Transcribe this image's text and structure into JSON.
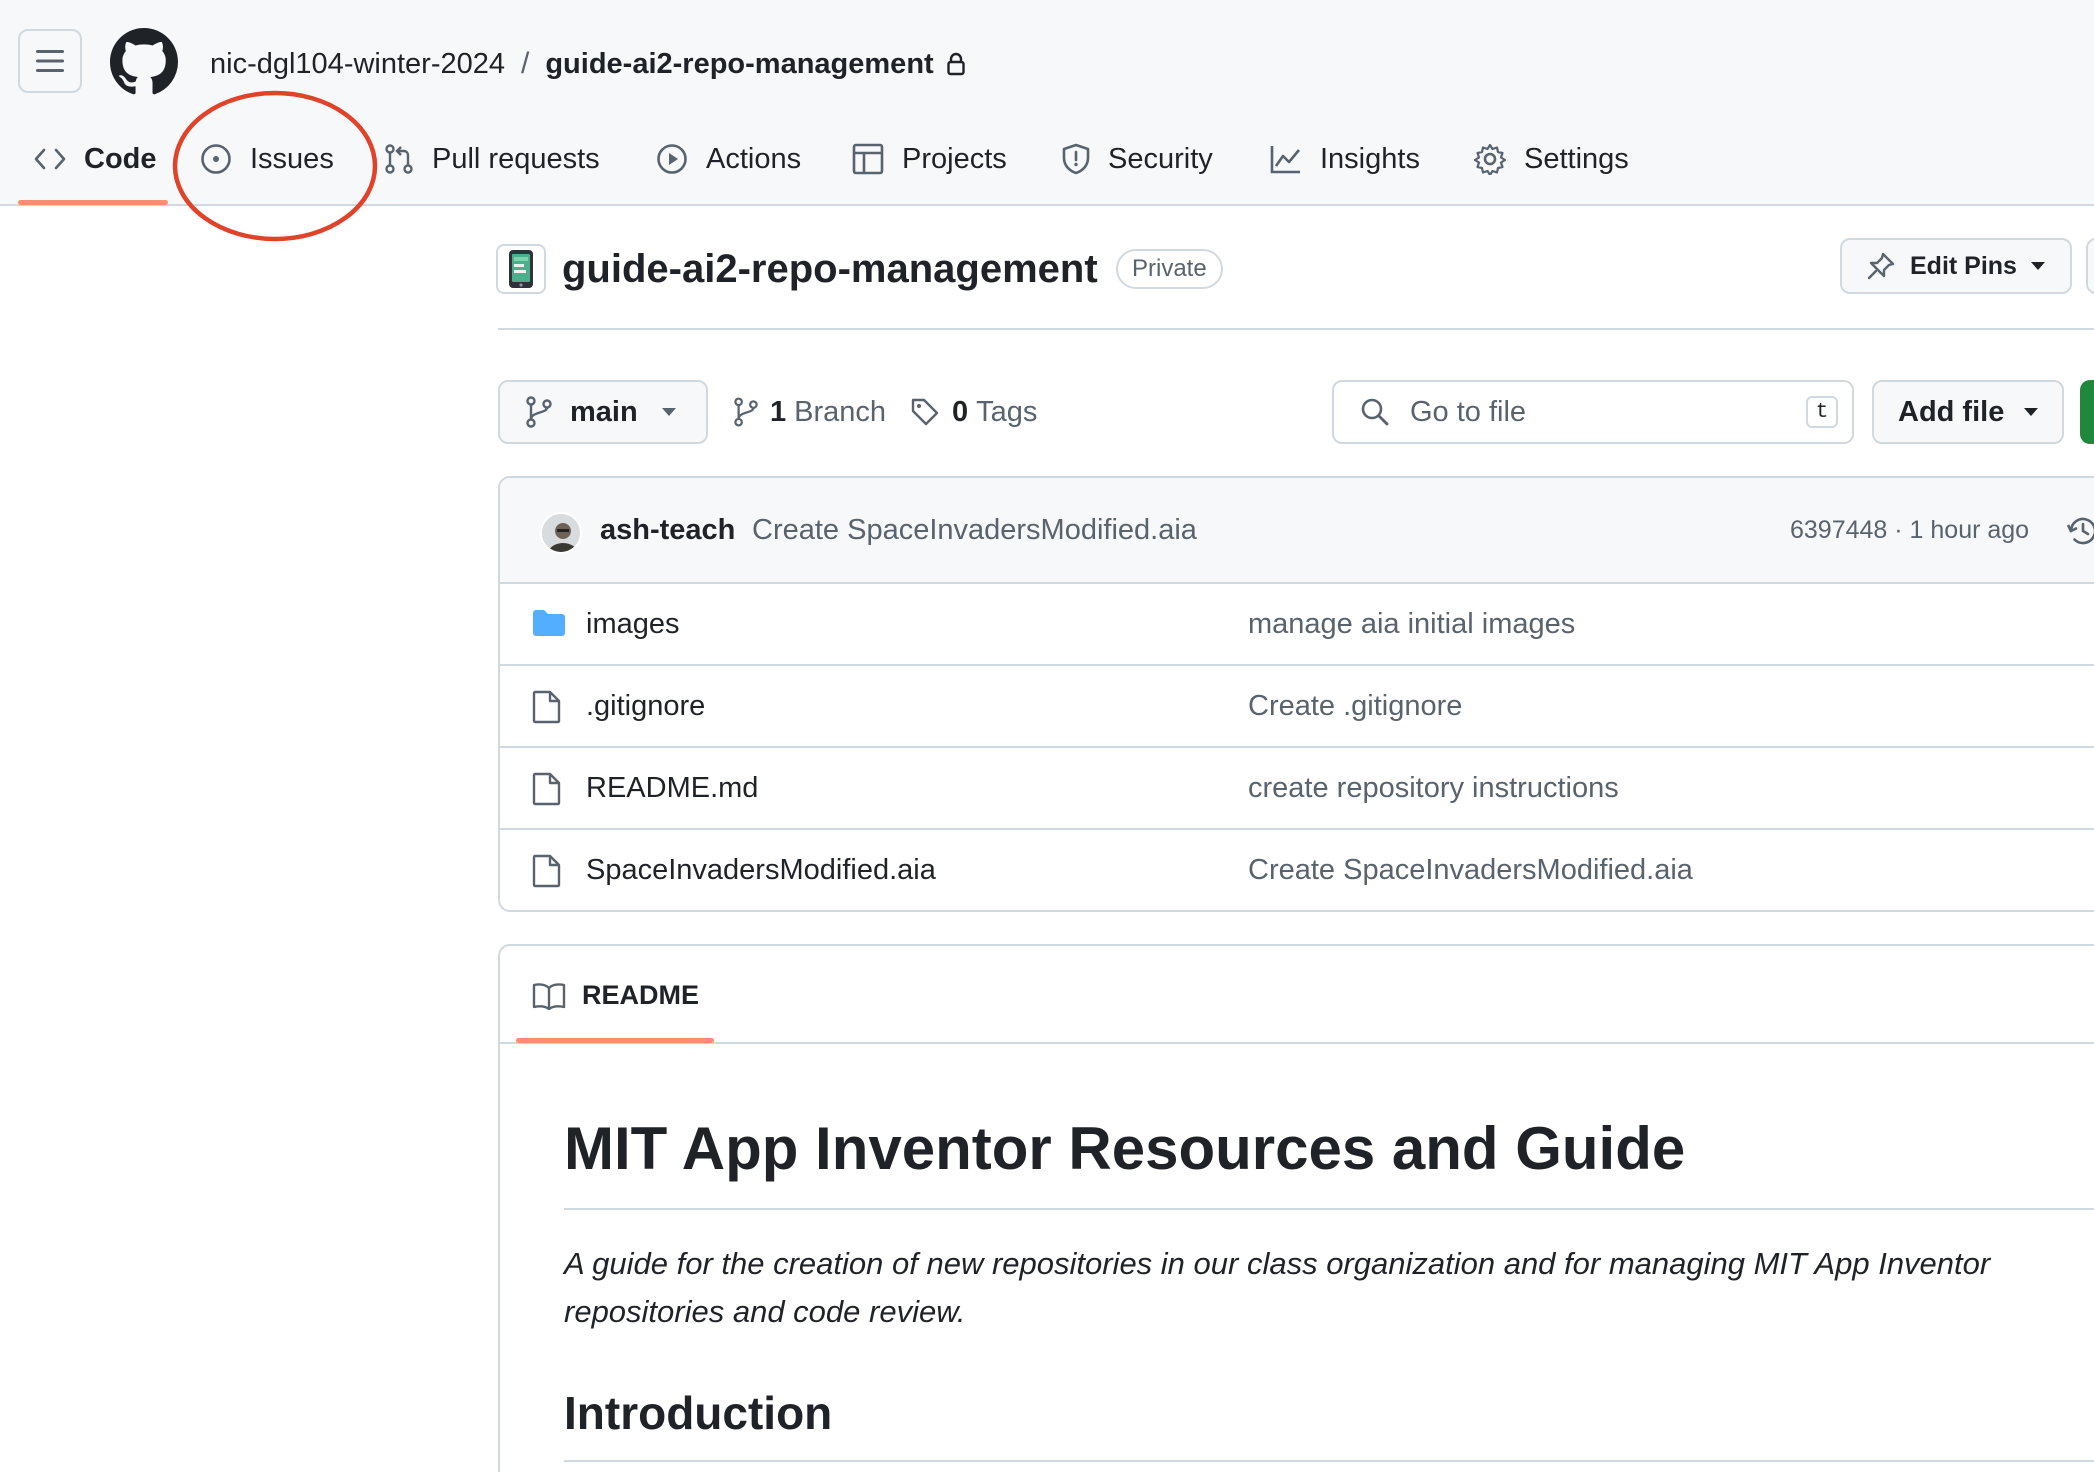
{
  "header": {
    "owner": "nic-dgl104-winter-2024",
    "separator": "/",
    "repo_name": "guide-ai2-repo-management"
  },
  "tabs": [
    {
      "label": "Code",
      "icon": "code-icon",
      "selected": true
    },
    {
      "label": "Issues",
      "icon": "issue-opened-icon",
      "selected": false
    },
    {
      "label": "Pull requests",
      "icon": "git-pull-request-icon",
      "selected": false
    },
    {
      "label": "Actions",
      "icon": "play-icon",
      "selected": false
    },
    {
      "label": "Projects",
      "icon": "table-icon",
      "selected": false
    },
    {
      "label": "Security",
      "icon": "shield-icon",
      "selected": false
    },
    {
      "label": "Insights",
      "icon": "graph-icon",
      "selected": false
    },
    {
      "label": "Settings",
      "icon": "gear-icon",
      "selected": false
    }
  ],
  "annotation": {
    "color": "#e0422a"
  },
  "repo": {
    "title": "guide-ai2-repo-management",
    "visibility": "Private",
    "edit_pins_label": "Edit Pins"
  },
  "branch": {
    "current": "main",
    "branch_count": "1",
    "branch_label": "Branch",
    "tag_count": "0",
    "tag_label": "Tags"
  },
  "search": {
    "placeholder": "Go to file",
    "shortcut": "t"
  },
  "add_file_label": "Add file",
  "latest_commit": {
    "author": "ash-teach",
    "message": "Create SpaceInvadersModified.aia",
    "meta": "6397448 · 1 hour ago"
  },
  "files": [
    {
      "name": "images",
      "type": "folder",
      "message": "manage aia initial images"
    },
    {
      "name": ".gitignore",
      "type": "file",
      "message": "Create .gitignore"
    },
    {
      "name": "README.md",
      "type": "file",
      "message": "create repository instructions"
    },
    {
      "name": "SpaceInvadersModified.aia",
      "type": "file",
      "message": "Create SpaceInvadersModified.aia"
    }
  ],
  "readme": {
    "tab_label": "README",
    "h1": "MIT App Inventor Resources and Guide",
    "intro": "A guide for the creation of new repositories in our class organization and for managing MIT App Inventor repositories and code review.",
    "h2": "Introduction"
  },
  "colors": {
    "accent_underline": "#fd8c73",
    "folder": "#54aeff",
    "code_button": "#1f883d",
    "muted_text": "#59636e",
    "border": "#d1d9e0"
  }
}
